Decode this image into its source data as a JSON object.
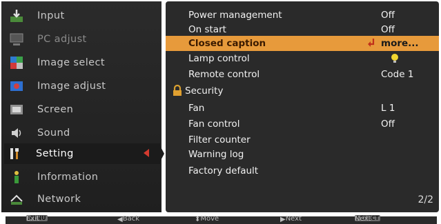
{
  "sidebar": {
    "items": [
      {
        "label": "Input",
        "icon": "input-icon"
      },
      {
        "label": "PC adjust",
        "icon": "monitor-icon"
      },
      {
        "label": "Image select",
        "icon": "image-select-icon"
      },
      {
        "label": "Image adjust",
        "icon": "image-adjust-icon"
      },
      {
        "label": "Screen",
        "icon": "screen-icon"
      },
      {
        "label": "Sound",
        "icon": "speaker-icon"
      },
      {
        "label": "Setting",
        "icon": "wrench-icon"
      },
      {
        "label": "Information",
        "icon": "info-person-icon"
      },
      {
        "label": "Network",
        "icon": "network-icon"
      }
    ],
    "selected_index": 6
  },
  "menu": {
    "rows": [
      {
        "label": "Power management",
        "value": "Off"
      },
      {
        "label": "On start",
        "value": "Off"
      },
      {
        "label": "Closed caption",
        "value": "more...",
        "highlighted": true
      },
      {
        "label": "Lamp control",
        "value": "",
        "value_icon": "bulb-icon"
      },
      {
        "label": "Remote control",
        "value": "Code 1"
      },
      {
        "label": "Security",
        "value": "",
        "label_icon": "lock-icon"
      },
      {
        "label": "Fan",
        "value": "L 1"
      },
      {
        "label": "Fan control",
        "value": "Off"
      },
      {
        "label": "Filter counter",
        "value": ""
      },
      {
        "label": "Warning log",
        "value": ""
      },
      {
        "label": "Factory default",
        "value": ""
      }
    ],
    "page": "2/2"
  },
  "footer": {
    "exit_key": "MENU",
    "exit": "Exit",
    "back": "Back",
    "move": "Move",
    "next": "Next",
    "select_key": "SELECT",
    "select_next": "Next"
  },
  "colors": {
    "highlight": "#e79a3b",
    "background": "#2a2a2a",
    "accent": "#d43a2f"
  }
}
